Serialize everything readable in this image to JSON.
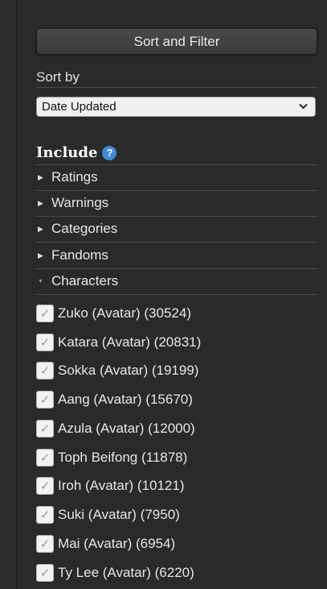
{
  "sidebar": {
    "sort_filter_button": "Sort and Filter",
    "sort_by_label": "Sort by",
    "sort_by_value": "Date Updated",
    "include_heading": "Include",
    "help_glyph": "?",
    "sections": [
      {
        "label": "Ratings",
        "expanded": false
      },
      {
        "label": "Warnings",
        "expanded": false
      },
      {
        "label": "Categories",
        "expanded": false
      },
      {
        "label": "Fandoms",
        "expanded": false
      },
      {
        "label": "Characters",
        "expanded": true
      }
    ],
    "characters": [
      {
        "label": "Zuko (Avatar) (30524)",
        "checked": true
      },
      {
        "label": "Katara (Avatar) (20831)",
        "checked": true
      },
      {
        "label": "Sokka (Avatar) (19199)",
        "checked": true
      },
      {
        "label": "Aang (Avatar) (15670)",
        "checked": true
      },
      {
        "label": "Azula (Avatar) (12000)",
        "checked": true
      },
      {
        "label": "Toph Beifong (11878)",
        "checked": true
      },
      {
        "label": "Iroh (Avatar) (10121)",
        "checked": true
      },
      {
        "label": "Suki (Avatar) (7950)",
        "checked": true
      },
      {
        "label": "Mai (Avatar) (6954)",
        "checked": true
      },
      {
        "label": "Ty Lee (Avatar) (6220)",
        "checked": true
      }
    ]
  },
  "icons": {
    "collapsed_arrow": "▶",
    "expanded_arrow": "▼",
    "check": "✓",
    "select_chevron": "⌄"
  },
  "colors": {
    "background": "#2a2a2a",
    "help_icon": "#3f8ad8",
    "divider": "#4a4a4a"
  }
}
